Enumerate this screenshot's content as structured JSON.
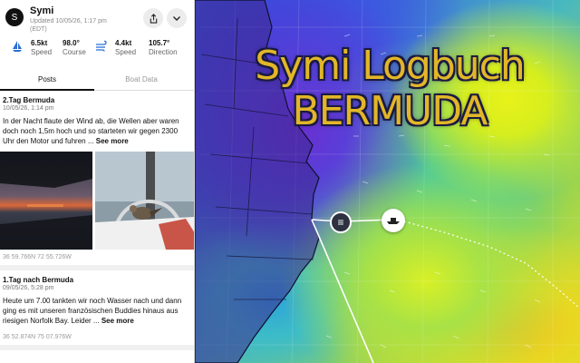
{
  "map": {
    "title_line1": "Symi Logbuch",
    "title_line2": "BERMUDA",
    "log_pin_icon": "list-icon",
    "boat_marker_icon": "boat-icon"
  },
  "header": {
    "avatar_letter": "S",
    "boat_name": "Symi",
    "updated": "Updated 10/05/26, 1:17 pm (EDT)"
  },
  "stats": [
    {
      "value": "6.5kt",
      "label": "Speed",
      "icon": "sailboat-icon"
    },
    {
      "value": "98.0°",
      "label": "Course",
      "icon": "compass-icon"
    },
    {
      "value": "4.4kt",
      "label": "Speed",
      "icon": "wind-icon"
    },
    {
      "value": "105.7°",
      "label": "Direction",
      "icon": "wind-direction-icon"
    }
  ],
  "tabs": [
    {
      "label": "Posts",
      "active": true
    },
    {
      "label": "Boat Data",
      "active": false
    }
  ],
  "posts": [
    {
      "title": "2.Tag Bermuda",
      "date": "10/05/26, 1:14 pm",
      "body": "In der Nacht flaute der Wind ab, die Wellen aber waren doch noch 1,5m hoch und so starteten wir gegen 2300 Uhr den Motor und fuhren ...",
      "more": "See more",
      "coords": "36 59.766N 72 55.726W"
    },
    {
      "title": "1.Tag nach Bermuda",
      "date": "09/05/26, 5:28 pm",
      "body": "Heute um 7.00 tankten wir noch Wasser nach und dann ging es mit unseren französischen Buddies hinaus aus riesigen Norfolk Bay. Leider ...",
      "more": "See more",
      "coords": "36 52.874N 75 07.976W"
    }
  ],
  "colors": {
    "accent": "#111111",
    "title_gold": "#e2b628",
    "stat_icon_blue": "#2a6fd6"
  }
}
